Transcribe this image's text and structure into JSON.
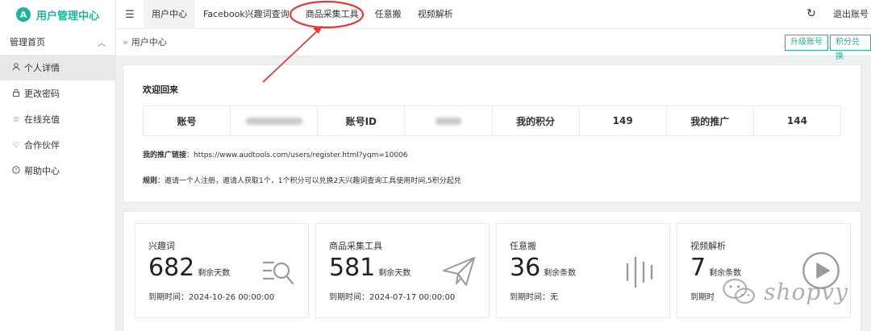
{
  "brand": {
    "logo": "A",
    "title": "用户管理中心"
  },
  "topnav": {
    "collapse_icon": "menu-fold-icon",
    "items": [
      "用户中心",
      "Facebook兴趣词查询",
      "商品采集工具",
      "任意搬",
      "视频解析"
    ],
    "refresh_icon": "refresh-icon",
    "logout": "退出账号"
  },
  "sidebar": {
    "head": "管理首页",
    "items": [
      {
        "label": "个人详情",
        "icon": "user-icon"
      },
      {
        "label": "更改密码",
        "icon": "lock-icon"
      },
      {
        "label": "在线充值",
        "icon": "star-icon"
      },
      {
        "label": "合作伙伴",
        "icon": "heart-icon"
      },
      {
        "label": "帮助中心",
        "icon": "help-icon"
      }
    ]
  },
  "breadcrumb": {
    "sep": "»",
    "current": "用户中心"
  },
  "actions": {
    "upgrade": "升级账号",
    "points": "积分兑换"
  },
  "welcome": {
    "title": "欢迎回来",
    "table": {
      "account_label": "账号",
      "account_id_label": "账号ID",
      "points_label": "我的积分",
      "points_value": "149",
      "promo_label": "我的推广",
      "promo_value": "144"
    },
    "promo_link_label": "我的推广链接",
    "promo_link": "：https://www.audtools.com/users/register.html?yqm=10006",
    "rule_label": "规则",
    "rule_text": "：邀请一个人注册，邀请人获取1个，1个积分可以兑换2天兴趣词查询工具使用时间,5积分起兑"
  },
  "stats": [
    {
      "label": "兴趣词",
      "number": "682",
      "unit": "剩余天数",
      "expire": "到期时间：2024-10-26 00:00:00",
      "icon": "search-list-icon"
    },
    {
      "label": "商品采集工具",
      "number": "581",
      "unit": "剩余天数",
      "expire": "到期时间：2024-07-17 00:00:00",
      "icon": "paper-plane-icon"
    },
    {
      "label": "任意搬",
      "number": "36",
      "unit": "剩余条数",
      "expire": "到期时间：无",
      "icon": "bars-icon"
    },
    {
      "label": "视频解析",
      "number": "7",
      "unit": "剩余条数",
      "expire": "到期时",
      "icon": "play-circle-icon"
    }
  ],
  "watermark": {
    "text": "shopvy",
    "icon": "wechat-icon"
  },
  "colors": {
    "accent": "#1fb39a",
    "annotation": "#e53935"
  }
}
